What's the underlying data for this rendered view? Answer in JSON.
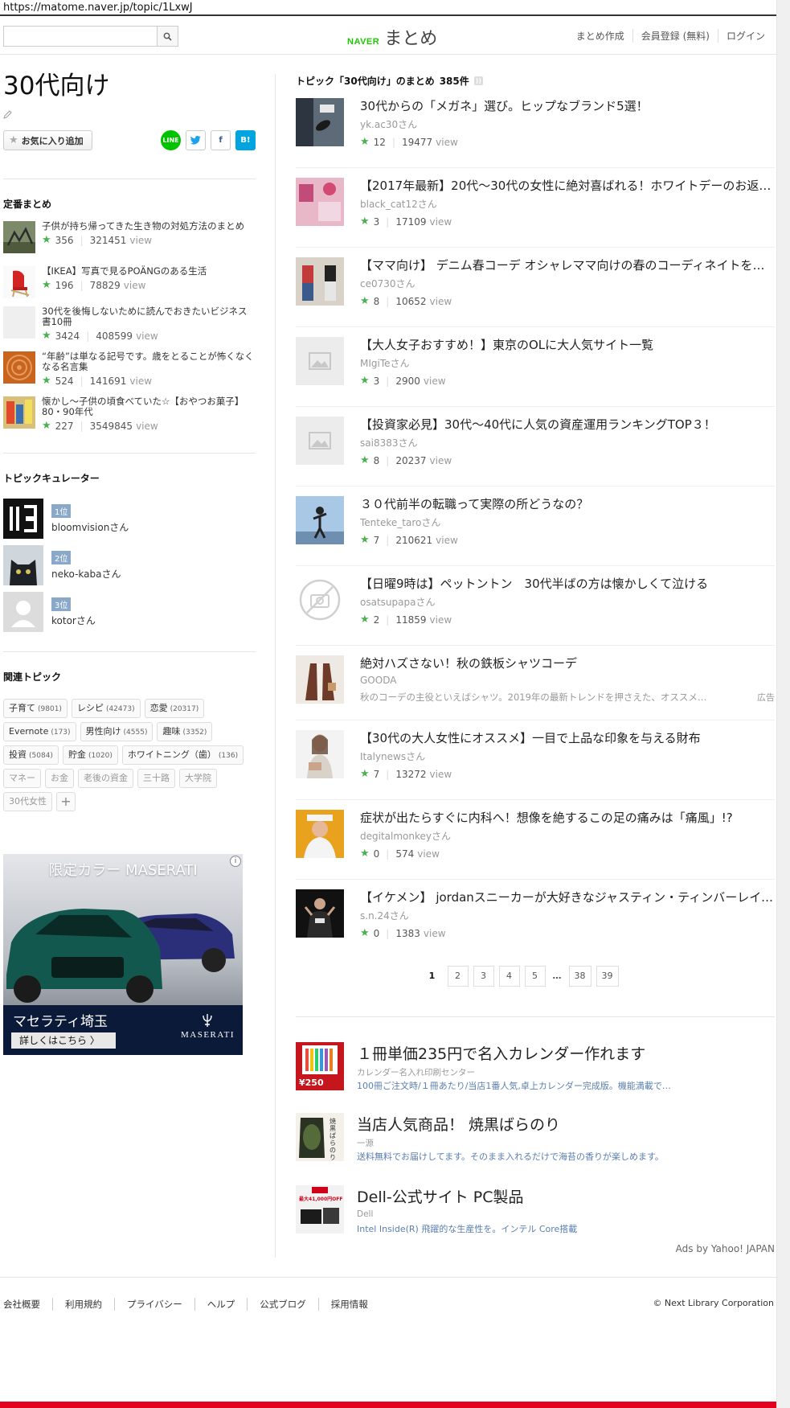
{
  "browser": {
    "url": "https://matome.naver.jp/topic/1LxwJ"
  },
  "header": {
    "search_placeholder": "",
    "logo_brand": "NAVER",
    "logo_text": "まとめ",
    "nav": [
      "まとめ作成",
      "会員登録 (無料)",
      "ログイン"
    ]
  },
  "topic": {
    "title": "30代向け",
    "fav_button": "お気に入り追加",
    "share": {
      "line": "LINE",
      "fb": "f",
      "hatena": "B!"
    }
  },
  "teiban": {
    "title": "定番まとめ",
    "items": [
      {
        "title": "子供が持ち帰ってきた生き物の対処方法のまとめ",
        "fav": "356",
        "views": "321451",
        "view_label": "view"
      },
      {
        "title": "【IKEA】写真で見るPOÄNGのある生活",
        "fav": "196",
        "views": "78829",
        "view_label": "view"
      },
      {
        "title": "30代を後悔しないために読んでおきたいビジネス書10冊",
        "fav": "3424",
        "views": "408599",
        "view_label": "view"
      },
      {
        "title": "“年齢”は単なる記号です。歳をとることが怖くなくなる名言集",
        "fav": "524",
        "views": "141691",
        "view_label": "view"
      },
      {
        "title": "懐かし～子供の頃食べていた☆【おやつお菓子】 80・90年代",
        "fav": "227",
        "views": "3549845",
        "view_label": "view"
      }
    ]
  },
  "curators": {
    "title": "トピックキュレーター",
    "items": [
      {
        "rank": "1位",
        "name": "bloomvisionさん"
      },
      {
        "rank": "2位",
        "name": "neko-kabaさん"
      },
      {
        "rank": "3位",
        "name": "kotorさん"
      }
    ]
  },
  "related": {
    "title": "関連トピック",
    "tags": [
      {
        "label": "子育て",
        "count": "(9801)",
        "gray": false
      },
      {
        "label": "レシピ",
        "count": "(42473)",
        "gray": false
      },
      {
        "label": "恋愛",
        "count": "(20317)",
        "gray": false
      },
      {
        "label": "Evernote",
        "count": "(173)",
        "gray": false
      },
      {
        "label": "男性向け",
        "count": "(4555)",
        "gray": false
      },
      {
        "label": "趣味",
        "count": "(3352)",
        "gray": false
      },
      {
        "label": "投資",
        "count": "(5084)",
        "gray": false
      },
      {
        "label": "貯金",
        "count": "(1020)",
        "gray": false
      },
      {
        "label": "ホワイトニング（歯）",
        "count": "(136)",
        "gray": false
      },
      {
        "label": "マネー",
        "count": "",
        "gray": true
      },
      {
        "label": "お金",
        "count": "",
        "gray": true
      },
      {
        "label": "老後の資金",
        "count": "",
        "gray": true
      },
      {
        "label": "三十路",
        "count": "",
        "gray": true
      },
      {
        "label": "大学院",
        "count": "",
        "gray": true
      },
      {
        "label": "30代女性",
        "count": "",
        "gray": true
      }
    ],
    "plus": "+"
  },
  "side_ad": {
    "headline": "限定カラー MASERATI",
    "dealer": "マセラティ埼玉",
    "cta": "詳しくはこちら",
    "brand": "MASERATI",
    "adchoice": "i"
  },
  "list": {
    "heading": "トピック「30代向け」のまとめ",
    "count": "385件",
    "articles": [
      {
        "title": "30代からの「メガネ」選び。ヒップなブランド5選！",
        "user": "yk.ac30さん",
        "fav": "12",
        "views": "19477",
        "view_label": "view",
        "thumb": "photo-dark",
        "ad": false
      },
      {
        "title": "【2017年最新】20代～30代の女性に絶対喜ばれる！ホワイトデーのお返し…",
        "user": "black_cat12さん",
        "fav": "3",
        "views": "17109",
        "view_label": "view",
        "thumb": "photo-pink",
        "ad": false
      },
      {
        "title": "【ママ向け】 デニム春コーデ オシャレママ向けの春のコーディネイトを…",
        "user": "ce0730さん",
        "fav": "8",
        "views": "10652",
        "view_label": "view",
        "thumb": "photo-fashion",
        "ad": false
      },
      {
        "title": "【大人女子おすすめ！】東京のOLに大人気サイト一覧",
        "user": "MIgiTeさん",
        "fav": "3",
        "views": "2900",
        "view_label": "view",
        "thumb": "placeholder",
        "ad": false
      },
      {
        "title": "【投資家必見】30代～40代に人気の資産運用ランキングTOP３！",
        "user": "sai8383さん",
        "fav": "8",
        "views": "20237",
        "view_label": "view",
        "thumb": "placeholder",
        "ad": false
      },
      {
        "title": "３０代前半の転職って実際の所どうなの？",
        "user": "Tenteke_taroさん",
        "fav": "7",
        "views": "210621",
        "view_label": "view",
        "thumb": "photo-sky",
        "ad": false
      },
      {
        "title": "【日曜9時は】ペットントン　30代半ばの方は懐かしくて泣ける",
        "user": "osatsupapaさん",
        "fav": "2",
        "views": "11859",
        "view_label": "view",
        "thumb": "no-image",
        "ad": false
      },
      {
        "title": "絶対ハズさない！秋の鉄板シャツコーデ",
        "user": "GOODA",
        "desc": "秋のコーデの主役といえばシャツ。2019年の最新トレンドを押さえた、オススメ…",
        "ad_label": "広告",
        "thumb": "photo-shirt",
        "ad": true
      },
      {
        "title": "【30代の大人女性にオススメ】一目で上品な印象を与える財布",
        "user": "Italynewsさん",
        "fav": "7",
        "views": "13272",
        "view_label": "view",
        "thumb": "photo-woman",
        "ad": false
      },
      {
        "title": "症状が出たらすぐに内科へ！想像を絶するこの足の痛みは「痛風」!?",
        "user": "degitalmonkeyさん",
        "fav": "0",
        "views": "574",
        "view_label": "view",
        "thumb": "photo-orange",
        "ad": false
      },
      {
        "title": "【イケメン】 jordanスニーカーが大好きなジャスティン・ティンバーレイク…",
        "user": "s.n.24さん",
        "fav": "0",
        "views": "1383",
        "view_label": "view",
        "thumb": "photo-black",
        "ad": false
      }
    ]
  },
  "pager": [
    "1",
    "2",
    "3",
    "4",
    "5",
    "…",
    "38",
    "39"
  ],
  "pr": [
    {
      "title": "１冊単価235円で名入カレンダー作れます",
      "source": "カレンダー名入れ印刷センター",
      "desc": "100冊ご注文時/１冊あたり/当店1番人気,卓上カレンダー完成版。機能満載で…",
      "thumb_label": "¥250"
    },
    {
      "title": "当店人気商品！ 焼黒ばらのり",
      "source": "一源",
      "desc": "送料無料でお届けしてます。そのまま入れるだけで海苔の香りが楽しめます。",
      "thumb_label": "焼黒ばらのり"
    },
    {
      "title": "Dell-公式サイト PC製品",
      "source": "Dell",
      "desc": "Intel Inside(R) 飛躍的な生産性を。インテル Core搭載",
      "thumb_label": "最大41,000円OFF"
    }
  ],
  "ads_by": "Ads by Yahoo! JAPAN",
  "footer": {
    "links": [
      "会社概要",
      "利用規約",
      "プライバシー",
      "ヘルプ",
      "公式ブログ",
      "採用情報"
    ],
    "copyright": "© Next Library Corporation"
  },
  "colors": {
    "accent_green": "#4caf50",
    "naver_green": "#1ec800",
    "rank_blue": "#8aa8c8",
    "ad_navy": "#0c1a3a",
    "bottom_red": "#e5001f"
  }
}
